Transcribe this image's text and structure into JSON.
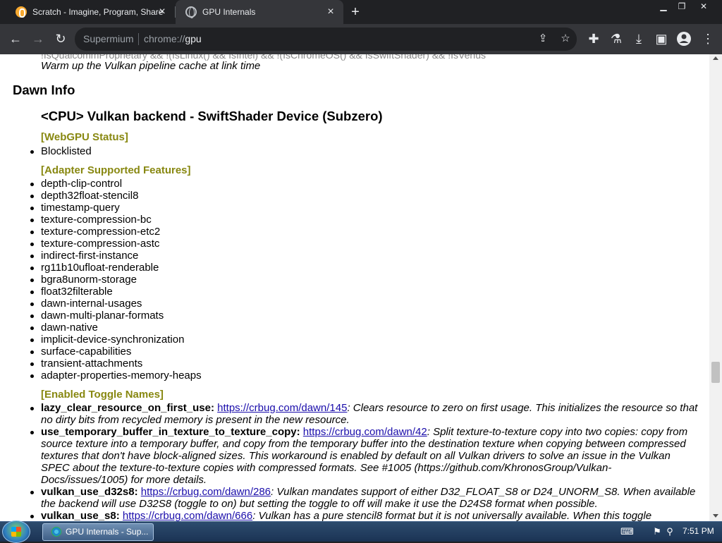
{
  "browser": {
    "tabs": [
      {
        "title": "Scratch - Imagine, Program, Share",
        "active": false
      },
      {
        "title": "GPU Internals",
        "active": true
      }
    ],
    "omnibox": {
      "site_label": "Supermium",
      "url_scheme": "chrome://",
      "url_host": "gpu"
    }
  },
  "page": {
    "cut_off_line": "!IsQualcommProprietary && !(IsLinux() && IsIntel) && !(IsChromeOS() && IsSwiftShader) && !IsVenus",
    "italic_line": "Warm up the Vulkan pipeline cache at link time",
    "dawn_heading": "Dawn Info",
    "device_heading": "<CPU> Vulkan backend - SwiftShader Device (Subzero)",
    "webgpu_status_label": "[WebGPU Status]",
    "webgpu_status_items": [
      "Blocklisted"
    ],
    "features_label": "[Adapter Supported Features]",
    "features": [
      "depth-clip-control",
      "depth32float-stencil8",
      "timestamp-query",
      "texture-compression-bc",
      "texture-compression-etc2",
      "texture-compression-astc",
      "indirect-first-instance",
      "rg11b10ufloat-renderable",
      "bgra8unorm-storage",
      "float32filterable",
      "dawn-internal-usages",
      "dawn-multi-planar-formats",
      "dawn-native",
      "implicit-device-synchronization",
      "surface-capabilities",
      "transient-attachments",
      "adapter-properties-memory-heaps"
    ],
    "toggles_label": "[Enabled Toggle Names]",
    "toggles": [
      {
        "name": "lazy_clear_resource_on_first_use:",
        "link": "https://crbug.com/dawn/145",
        "desc": ": Clears resource to zero on first usage. This initializes the resource so that no dirty bits from recycled memory is present in the new resource."
      },
      {
        "name": "use_temporary_buffer_in_texture_to_texture_copy:",
        "link": "https://crbug.com/dawn/42",
        "desc": ": Split texture-to-texture copy into two copies: copy from source texture into a temporary buffer, and copy from the temporary buffer into the destination texture when copying between compressed textures that don't have block-aligned sizes. This workaround is enabled by default on all Vulkan drivers to solve an issue in the Vulkan SPEC about the texture-to-texture copies with compressed formats. See #1005 (https://github.com/KhronosGroup/Vulkan-Docs/issues/1005) for more details."
      },
      {
        "name": "vulkan_use_d32s8:",
        "link": "https://crbug.com/dawn/286",
        "desc": ": Vulkan mandates support of either D32_FLOAT_S8 or D24_UNORM_S8. When available the backend will use D32S8 (toggle to on) but setting the toggle to off will make it use the D24S8 format when possible."
      },
      {
        "name": "vulkan_use_s8:",
        "link": "https://crbug.com/dawn/666",
        "desc": ": Vulkan has a pure stencil8 format but it is not universally available. When this toggle"
      }
    ]
  },
  "taskbar": {
    "task_label": "GPU Internals - Sup...",
    "clock": "7:51 PM"
  },
  "icons": {
    "back": "arrow-left-icon",
    "forward": "arrow-right-icon",
    "reload": "reload-icon",
    "share": "share-icon",
    "bookmark": "star-icon",
    "extensions": "puzzle-icon",
    "labs": "flask-icon",
    "downloads": "download-icon",
    "sidepanel": "side-panel-icon",
    "profile": "profile-icon",
    "menu": "kebab-menu-icon"
  }
}
